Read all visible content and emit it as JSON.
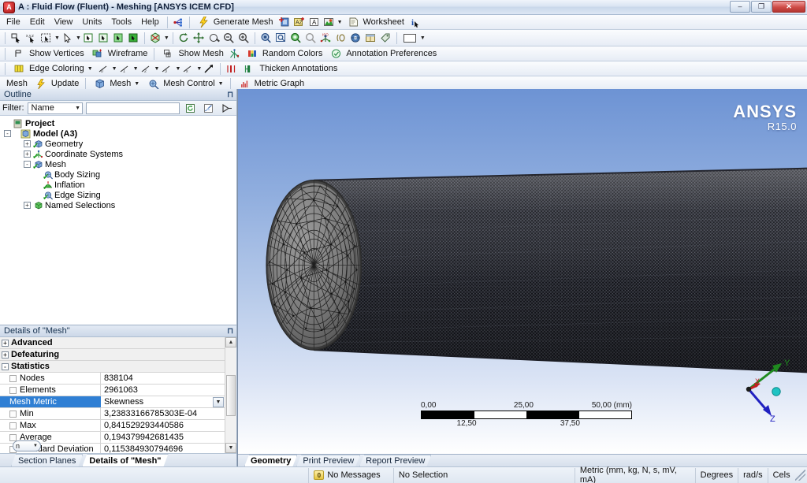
{
  "window": {
    "title": "A : Fluid Flow (Fluent) - Meshing [ANSYS ICEM CFD]",
    "app_icon": "ansys-workbench-icon",
    "minimize": "–",
    "maximize": "❐",
    "close": "✕"
  },
  "menu": {
    "items": [
      {
        "label": "File"
      },
      {
        "label": "Edit"
      },
      {
        "label": "View"
      },
      {
        "label": "Units"
      },
      {
        "label": "Tools"
      },
      {
        "label": "Help"
      }
    ],
    "commands": [
      {
        "label": "Generate Mesh",
        "icon": "lightning-icon"
      },
      {
        "label": "Worksheet",
        "icon": "worksheet-icon"
      }
    ],
    "info_icon": "info-icon"
  },
  "toolbar_select": {
    "icons": [
      "select-mode-icon",
      "select-xyz-icon",
      "pick-box-select-icon",
      "cursor-mode-icon",
      "select-vertex-icon",
      "select-edge-icon",
      "select-face-icon",
      "select-body-icon",
      "extend-selection-icon",
      "rotate-icon",
      "pan-icon",
      "zoom-icon",
      "zoom-out-icon",
      "zoom-in-icon",
      "box-zoom-icon",
      "zoom-to-fit-icon",
      "magnify-icon",
      "previous-view-icon",
      "iso-view-icon",
      "look-at-icon",
      "set-view-icon",
      "viewports-icon",
      "label-icon",
      "window-color-icon"
    ]
  },
  "toolbar_display": {
    "buttons": [
      {
        "label": "Show Vertices",
        "icon": "show-vertices-icon"
      },
      {
        "label": "Wireframe",
        "icon": "wireframe-icon"
      },
      {
        "label": "Show Mesh",
        "icon": "show-mesh-icon"
      },
      {
        "label": "",
        "icon": "probe-icon"
      },
      {
        "label": "Random Colors",
        "icon": "random-colors-icon"
      },
      {
        "label": "Annotation Preferences",
        "icon": "annotation-preferences-icon"
      }
    ]
  },
  "toolbar_edge": {
    "buttons": [
      {
        "label": "Edge Coloring",
        "icon": "edge-coloring-icon",
        "has_caret": true
      },
      {
        "label": "",
        "icon": "thickness-0-icon",
        "has_caret": true
      },
      {
        "label": "",
        "icon": "thickness-1-icon",
        "has_caret": true
      },
      {
        "label": "",
        "icon": "thickness-2-icon",
        "has_caret": true
      },
      {
        "label": "",
        "icon": "thickness-3-icon",
        "has_caret": true
      },
      {
        "label": "",
        "icon": "thickness-x-icon",
        "has_caret": true
      },
      {
        "label": "",
        "icon": "arrow-icon",
        "has_caret": false
      },
      {
        "label": "",
        "icon": "annotation-scale-icon",
        "has_caret": false
      },
      {
        "label": "Thicken Annotations",
        "icon": "thicken-annotations-icon",
        "has_caret": false
      }
    ]
  },
  "toolbar_mesh": {
    "buttons": [
      {
        "label": "Mesh",
        "icon": ""
      },
      {
        "label": "Update",
        "icon": "lightning-icon"
      },
      {
        "label": "Mesh",
        "icon": "mesh-icon",
        "has_caret": true
      },
      {
        "label": "Mesh Control",
        "icon": "mesh-control-icon",
        "has_caret": true
      },
      {
        "label": "Metric Graph",
        "icon": "metric-graph-icon"
      }
    ]
  },
  "outline": {
    "title": "Outline",
    "pin_icon": "pin-icon",
    "filter": {
      "label": "Filter:",
      "selected": "Name",
      "value": "",
      "placeholder": "",
      "buttons": [
        "refresh-icon",
        "clear-filter-icon",
        "expand-filter-icon"
      ]
    },
    "tree": [
      {
        "label": "Project",
        "indent": 0,
        "expander": "",
        "icon": "project-icon",
        "check": false,
        "bold": true
      },
      {
        "label": "Model (A3)",
        "indent": 1,
        "expander": "-",
        "icon": "model-icon",
        "check": false,
        "bold": true
      },
      {
        "label": "Geometry",
        "indent": 2,
        "expander": "+",
        "icon": "geometry-icon",
        "check": true,
        "bold": false
      },
      {
        "label": "Coordinate Systems",
        "indent": 2,
        "expander": "+",
        "icon": "coordinate-systems-icon",
        "check": true,
        "bold": false
      },
      {
        "label": "Mesh",
        "indent": 2,
        "expander": "-",
        "icon": "mesh-icon",
        "check": true,
        "bold": false
      },
      {
        "label": "Body Sizing",
        "indent": 3,
        "expander": "",
        "icon": "body-sizing-icon",
        "check": true,
        "bold": false
      },
      {
        "label": "Inflation",
        "indent": 3,
        "expander": "",
        "icon": "inflation-icon",
        "check": true,
        "bold": false
      },
      {
        "label": "Edge Sizing",
        "indent": 3,
        "expander": "",
        "icon": "edge-sizing-icon",
        "check": true,
        "bold": false
      },
      {
        "label": "Named Selections",
        "indent": 2,
        "expander": "+",
        "icon": "named-selections-icon",
        "check": false,
        "bold": false
      }
    ]
  },
  "details": {
    "title": "Details of \"Mesh\"",
    "pin_icon": "pin-icon",
    "rows": [
      {
        "type": "category",
        "expander": "+",
        "name": "Advanced",
        "value": ""
      },
      {
        "type": "category",
        "expander": "+",
        "name": "Defeaturing",
        "value": ""
      },
      {
        "type": "category",
        "expander": "-",
        "name": "Statistics",
        "value": ""
      },
      {
        "type": "field",
        "name": "Nodes",
        "value": "838104",
        "selected": false,
        "combo": false
      },
      {
        "type": "field",
        "name": "Elements",
        "value": "2961063",
        "selected": false,
        "combo": false
      },
      {
        "type": "field",
        "name": "Mesh Metric",
        "value": "Skewness",
        "selected": true,
        "combo": true
      },
      {
        "type": "field",
        "name": "Min",
        "value": "3,23833166785303E-04",
        "selected": false,
        "combo": false
      },
      {
        "type": "field",
        "name": "Max",
        "value": "0,841529293440586",
        "selected": false,
        "combo": false
      },
      {
        "type": "field",
        "name": "Average",
        "value": "0,194379942681435",
        "selected": false,
        "combo": false
      },
      {
        "type": "field",
        "name": "Standard Deviation",
        "value": "0,115384930794696",
        "selected": false,
        "combo": false
      }
    ],
    "mini_combo": "n",
    "scroll": {
      "up": "▲",
      "down": "▼"
    }
  },
  "left_tabs": [
    {
      "label": "Section Planes",
      "active": false
    },
    {
      "label": "Details of \"Mesh\"",
      "active": true
    }
  ],
  "graphics": {
    "logo": {
      "name": "ANSYS",
      "release": "R15.0"
    },
    "scale": {
      "top_labels": [
        "0,00",
        "25,00",
        "50,00 (mm)"
      ],
      "bottom_labels": [
        "12,50",
        "37,50"
      ],
      "segments": [
        true,
        false,
        true,
        false
      ]
    },
    "triad": {
      "x": "X",
      "y": "Y",
      "z": "Z"
    },
    "tabs": [
      {
        "label": "Geometry",
        "active": true
      },
      {
        "label": "Print Preview",
        "active": false
      },
      {
        "label": "Report Preview",
        "active": false
      }
    ]
  },
  "status": {
    "messages": "No Messages",
    "message_count": "0",
    "selection": "No Selection",
    "units": "Metric (mm, kg, N, s, mV, mA)",
    "angle": "Degrees",
    "rotation": "rad/s",
    "temperature": "Cels"
  }
}
